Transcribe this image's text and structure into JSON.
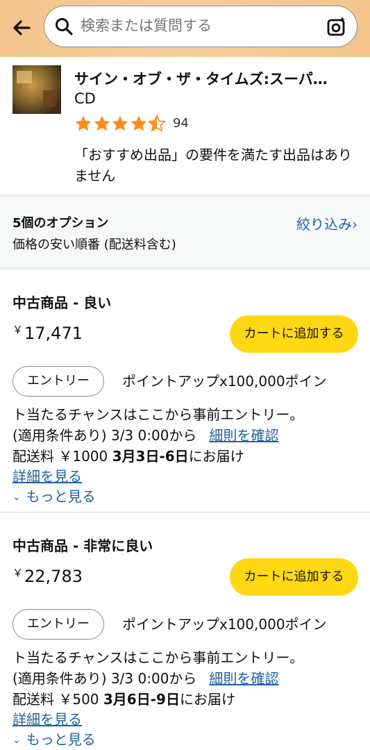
{
  "header": {
    "search_placeholder": "検索または質問する"
  },
  "product": {
    "title": "サイン・オブ・ザ・タイムズ:スーパ…",
    "format": "CD",
    "rating": 4.5,
    "rating_count": "94",
    "note": "「おすすめ出品」の要件を満たす出品はありません"
  },
  "options": {
    "count_label": "5個のオプション",
    "sort_label": "価格の安い順番 (配送料含む)",
    "filter_label": "絞り込み›"
  },
  "offers": [
    {
      "condition": "中古商品 - 良い",
      "currency": "￥",
      "price": "17,471",
      "cart_label": "カートに追加する",
      "entry_label": "エントリー",
      "promo_line1": "ポイントアップx100,000ポイン",
      "promo_line2": "ト当たるチャンスはここから事前エントリー。",
      "promo_line3": "(適用条件あり) 3/3 0:00から",
      "rule_link": "細則を確認",
      "ship_prefix": "配送料 ￥1000 ",
      "ship_date": "3月3日-6日",
      "ship_suffix": "にお届け",
      "details_label": "詳細を見る",
      "more_label": "もっと見る"
    },
    {
      "condition": "中古商品 - 非常に良い",
      "currency": "￥",
      "price": "22,783",
      "cart_label": "カートに追加する",
      "entry_label": "エントリー",
      "promo_line1": "ポイントアップx100,000ポイン",
      "promo_line2": "ト当たるチャンスはここから事前エントリー。",
      "promo_line3": "(適用条件あり) 3/3 0:00から",
      "rule_link": "細則を確認",
      "ship_prefix": "配送料 ￥500 ",
      "ship_date": "3月6日-9日",
      "ship_suffix": "にお届け",
      "details_label": "詳細を見る",
      "more_label": "もっと見る"
    }
  ],
  "colors": {
    "header_bg": "#f3c48c",
    "cart_button": "#ffd814",
    "link": "#2162a1",
    "star": "#ff8c1a"
  },
  "icons": {
    "back": "back-arrow-icon",
    "search": "search-icon",
    "camera": "camera-icon",
    "star": "star-icon",
    "chevron": "chevron-down-icon"
  }
}
